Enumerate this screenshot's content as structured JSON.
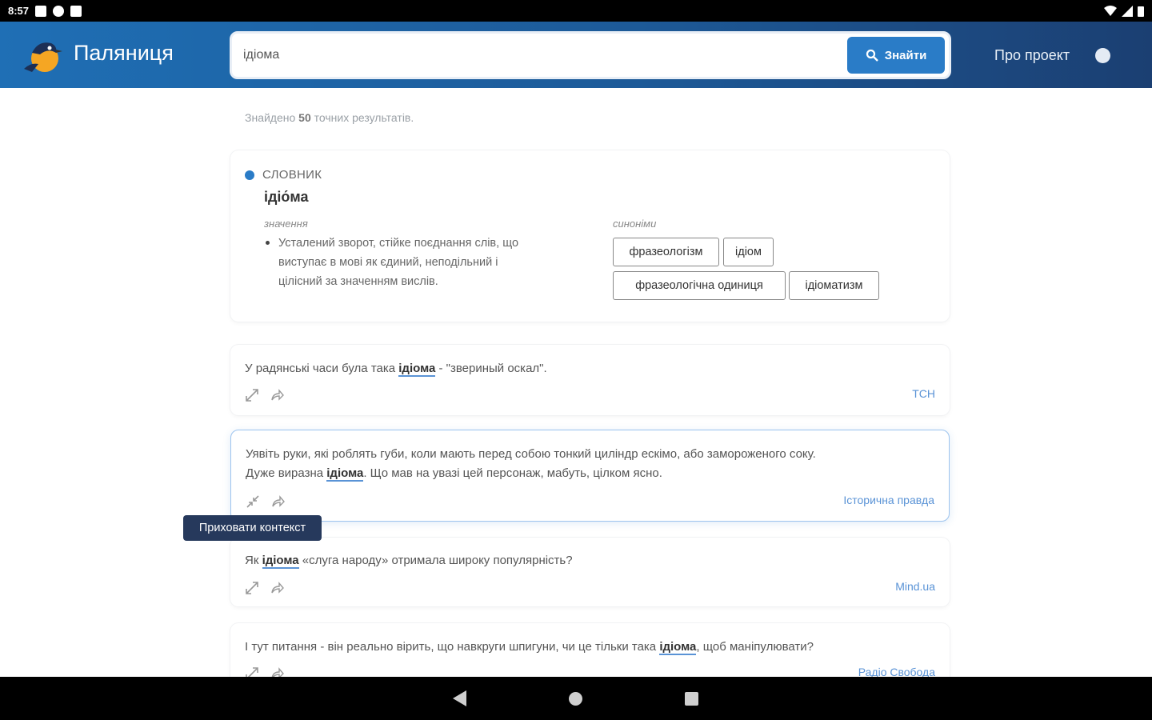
{
  "status": {
    "time": "8:57"
  },
  "header": {
    "brand": "Паляниця",
    "search_value": "ідіома",
    "search_button": "Знайти",
    "about": "Про проект"
  },
  "results": {
    "count_prefix": "Знайдено ",
    "count": "50",
    "count_suffix": " точних результатів."
  },
  "dictionary": {
    "label": "СЛОВНИК",
    "word": "ідіо́ма",
    "meaning_label": "значення",
    "meaning_line1": "Усталений зворот, стійке поєднання слів, що",
    "meaning_line2": "виступає в мові як єдиний, неподільний і",
    "meaning_line3": "цілісний за значенням вислів.",
    "synonyms_label": "синоніми",
    "synonyms": [
      "фразеологізм",
      "ідіом",
      "фразеологічна одиниця",
      "ідіоматизм"
    ]
  },
  "examples": [
    {
      "before": "У радянські часи була така ",
      "hl": "ідіома",
      "after": " - \"звериный оскал\".",
      "source": "ТСН"
    },
    {
      "line1": "Уявіть руки, які роблять губи, коли мають перед собою тонкий циліндр ескімо, або замороженого соку.",
      "before": "Дуже виразна ",
      "hl": "ідіома",
      "after": ". Що мав на увазі цей персонаж, мабуть, цілком ясно.",
      "source": "Історична правда"
    },
    {
      "before": "Як ",
      "hl": "ідіома",
      "after": " «слуга народу» отримала широку популярність?",
      "source": "Mind.ua"
    },
    {
      "before": "І тут питання - він реально вірить, що навкруги шпигуни, чи це тільки така ",
      "hl": "ідіома",
      "after": ", щоб маніпулювати?",
      "source": "Радіо Свобода"
    }
  ],
  "tooltip": "Приховати контекст"
}
